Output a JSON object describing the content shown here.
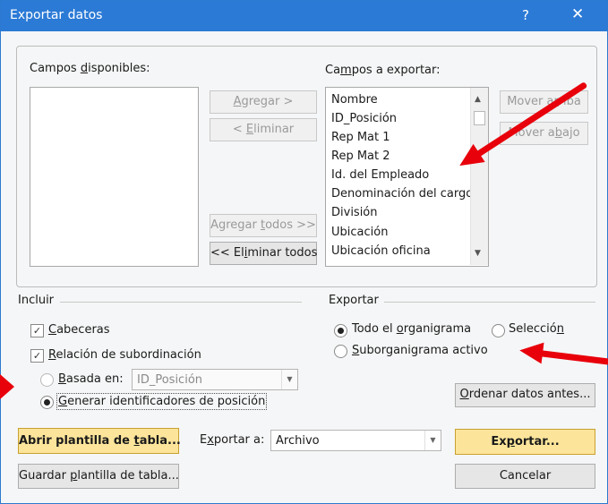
{
  "window": {
    "title": "Exportar datos",
    "help": "?",
    "close": "✕"
  },
  "available": {
    "label_pre": "Campos ",
    "label_acc": "d",
    "label_post": "isponibles:"
  },
  "export_fields": {
    "label_pre": "Ca",
    "label_acc": "m",
    "label_post": "pos a exportar:",
    "items": [
      "Nombre",
      "ID_Posición",
      "Rep Mat 1",
      "Rep Mat 2",
      "Id. del Empleado",
      "Denominación del cargo",
      "División",
      "Ubicación",
      "Ubicación oficina"
    ]
  },
  "buttons": {
    "add": {
      "pre": "",
      "acc": "A",
      "post": "gregar >"
    },
    "remove": {
      "pre": "< ",
      "acc": "E",
      "post": "liminar"
    },
    "add_all": {
      "pre": "Agregar ",
      "acc": "t",
      "post": "odos >>"
    },
    "remove_all": {
      "pre": "<< El",
      "acc": "i",
      "post": "minar todos"
    },
    "move_up": {
      "pre": "Mover a",
      "acc": "r",
      "post": "riba"
    },
    "move_down": {
      "pre": "Mover a",
      "acc": "b",
      "post": "ajo"
    },
    "sort": {
      "pre": "",
      "acc": "O",
      "post": "rdenar datos antes..."
    },
    "open_template": {
      "pre": "Abrir plantilla de ",
      "acc": "t",
      "post": "abla..."
    },
    "save_template": {
      "pre": "Guardar ",
      "acc": "p",
      "post": "lantilla de tabla..."
    },
    "export": {
      "pre": "Ex",
      "acc": "p",
      "post": "ortar..."
    },
    "cancel": "Cancelar"
  },
  "include": {
    "label": "Incluir",
    "headers": {
      "pre": "",
      "acc": "C",
      "post": "abeceras",
      "checked": true
    },
    "subordination": {
      "pre": "",
      "acc": "R",
      "post": "elación de subordinación",
      "checked": true
    },
    "based_on": {
      "pre": "",
      "acc": "B",
      "post": "asada en:",
      "selected": false,
      "value": "ID_Posición"
    },
    "generate_ids": {
      "pre": "",
      "acc": "G",
      "post": "enerar identificadores de posición",
      "selected": true
    }
  },
  "export": {
    "label": "Exportar",
    "whole": {
      "pre": "Todo el ",
      "acc": "o",
      "post": "rganigrama",
      "selected": true
    },
    "selection": {
      "pre": "Selecció",
      "acc": "n",
      "post": "",
      "selected": false
    },
    "active_sub": {
      "pre": "",
      "acc": "S",
      "post": "uborganigrama activo",
      "selected": false
    }
  },
  "export_to": {
    "label_pre": "E",
    "label_acc": "x",
    "label_post": "portar a:",
    "value": "Archivo"
  },
  "colors": {
    "title_bar": "#2b7ad6",
    "accent_button": "#fce59b",
    "annotation_arrow": "#e8000b"
  }
}
